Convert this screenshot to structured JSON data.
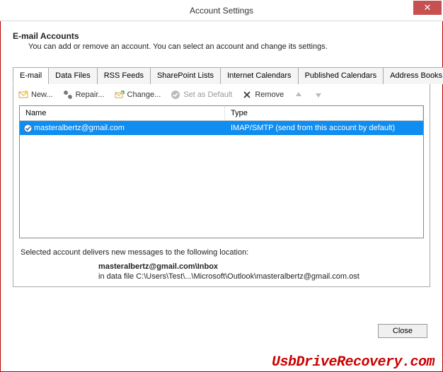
{
  "title": "Account Settings",
  "header": {
    "heading": "E-mail Accounts",
    "sub": "You can add or remove an account. You can select an account and change its settings."
  },
  "tabs": [
    {
      "label": "E-mail"
    },
    {
      "label": "Data Files"
    },
    {
      "label": "RSS Feeds"
    },
    {
      "label": "SharePoint Lists"
    },
    {
      "label": "Internet Calendars"
    },
    {
      "label": "Published Calendars"
    },
    {
      "label": "Address Books"
    }
  ],
  "toolbar": {
    "new": "New...",
    "repair": "Repair...",
    "change": "Change...",
    "setdefault": "Set as Default",
    "remove": "Remove"
  },
  "columns": {
    "name": "Name",
    "type": "Type"
  },
  "accounts": [
    {
      "name": "masteralbertz@gmail.com",
      "type": "IMAP/SMTP (send from this account by default)"
    }
  ],
  "location": {
    "intro": "Selected account delivers new messages to the following location:",
    "folder": "masteralbertz@gmail.com\\Inbox",
    "file": "in data file C:\\Users\\Test\\...\\Microsoft\\Outlook\\masteralbertz@gmail.com.ost"
  },
  "close_label": "Close",
  "watermark": "UsbDriveRecovery.com"
}
